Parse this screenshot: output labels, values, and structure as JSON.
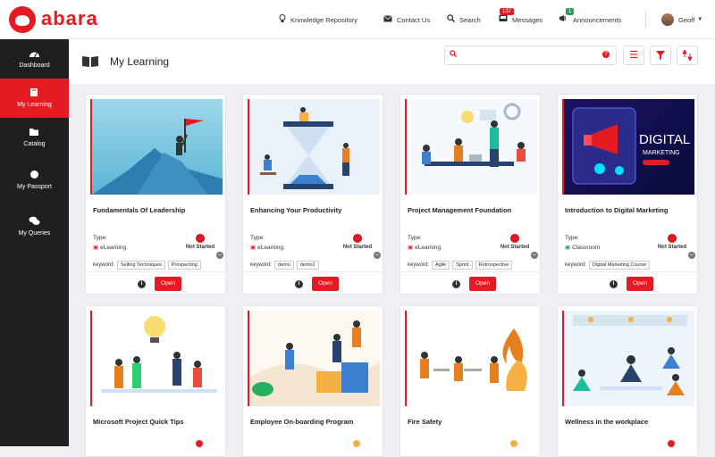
{
  "app": {
    "logo_text": "abara"
  },
  "topnav": {
    "knowledge": "Knowledge Repository",
    "contact": "Contact Us",
    "search": "Search",
    "messages": "Messages",
    "messages_count": "137",
    "announcements": "Announcements",
    "announcements_count": "1",
    "user": "Geoff"
  },
  "sidebar": {
    "items": [
      {
        "label": "Dashboard"
      },
      {
        "label": "My Learning"
      },
      {
        "label": "Catalog"
      },
      {
        "label": "My Passport"
      },
      {
        "label": "My Queries"
      }
    ]
  },
  "header": {
    "title": "My Learning",
    "search_placeholder": ""
  },
  "labels": {
    "type": "Type:",
    "keyword": "keyword:",
    "status": "Not Started",
    "open": "Open"
  },
  "cards": [
    {
      "title": "Fundamentals Of Leadership",
      "type": "eLearning",
      "keywords": [
        "Selling Techniques",
        "Prospecting"
      ]
    },
    {
      "title": "Enhancing Your Productivity",
      "type": "eLearning",
      "keywords": [
        "demo",
        "demo1"
      ]
    },
    {
      "title": "Project Management Foundation",
      "type": "eLearning",
      "keywords": [
        "Agile",
        "Sprint",
        "Retrospective"
      ]
    },
    {
      "title": "Introduction to Digital Marketing",
      "type": "Classroom",
      "keywords": [
        "Digital Marketing Course"
      ]
    },
    {
      "title": "Microsoft Project Quick Tips"
    },
    {
      "title": "Employee On-boarding Program"
    },
    {
      "title": "Fire Safety"
    },
    {
      "title": "Wellness in the workplace"
    }
  ],
  "thumb_text": {
    "digital": "DIGITAL",
    "marketing": "MARKETING"
  },
  "colors": {
    "accent": "#e51b24",
    "sidebar": "#1f1f1f",
    "classroom": "#2aa05c"
  }
}
